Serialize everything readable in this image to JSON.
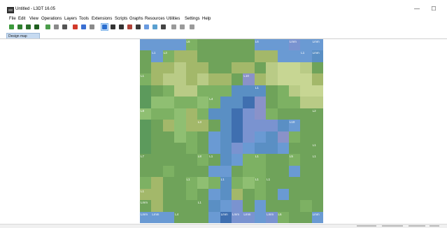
{
  "window": {
    "title": "Untitled - L3DT 16.05",
    "minimize_glyph": "—",
    "maximize_glyph": "☐"
  },
  "menu": {
    "items": [
      "File",
      "Edit",
      "View",
      "Operations",
      "Layers",
      "Tools",
      "Extensions",
      "Scripts",
      "Graphs",
      "Resources",
      "Utilities",
      "Settings",
      "Help"
    ]
  },
  "toolbar": {
    "buttons": [
      {
        "icon": "new-icon",
        "color": "#3c9a3c"
      },
      {
        "icon": "open-icon",
        "color": "#2f7f2f"
      },
      {
        "icon": "save-icon",
        "color": "#2a6f2a"
      },
      {
        "icon": "save-as-icon",
        "color": "#1f5f1f"
      },
      {
        "icon": "grid-icon",
        "color": "#4b9d4b"
      },
      {
        "icon": "arrows-icon",
        "color": "#8a8a8a"
      },
      {
        "icon": "stamp-icon",
        "color": "#555555"
      },
      {
        "icon": "pin-red-icon",
        "color": "#d23a2a"
      },
      {
        "icon": "pin-blue-icon",
        "color": "#3a6fd2"
      },
      {
        "icon": "filter-icon",
        "color": "#8a8a8a"
      },
      {
        "icon": "pointer-icon",
        "color": "#2b6fd0",
        "selected": true
      },
      {
        "icon": "pen-alt-icon",
        "color": "#333333"
      },
      {
        "icon": "pen-icon",
        "color": "#333333"
      },
      {
        "icon": "select-icon",
        "color": "#b0443a"
      },
      {
        "icon": "magnet-icon",
        "color": "#3a3a3a"
      },
      {
        "icon": "expand-icon",
        "color": "#6a9be0"
      },
      {
        "icon": "palette-icon",
        "color": "#5aa0d0"
      },
      {
        "icon": "flat-icon",
        "color": "#444444"
      },
      {
        "icon": "brush-icon",
        "color": "#9a9a9a"
      },
      {
        "icon": "terrain-icon",
        "color": "#9a9a9a"
      },
      {
        "icon": "number-icon",
        "color": "#9a9a9a"
      }
    ]
  },
  "tabs": [
    {
      "label": "Design map"
    }
  ],
  "colors": {
    "window_bg": "#ffffff",
    "tab_bg": "#c6daf1",
    "tab_border": "#9eb9d8",
    "map_label": "#ffffff",
    "terrain_legend": {
      "g1": "#6fa35a",
      "g2": "#7db163",
      "g3": "#8fbf72",
      "g4": "#5c9a5c",
      "y1": "#b9cb86",
      "y2": "#a3b86a",
      "y3": "#c7d693",
      "b1": "#5a8fc4",
      "b2": "#6a9ad3",
      "b3": "#7a93d0",
      "b4": "#3f6fb0",
      "b5": "#8a92c9"
    }
  },
  "map": {
    "grid_cols": 16,
    "grid_rows": 16,
    "terrain_rows": [
      [
        "b2",
        "b2",
        "b2",
        "b2",
        "g2",
        "g1",
        "g1",
        "g1",
        "g1",
        "g1",
        "b2",
        "b2",
        "b2",
        "b3",
        "b2",
        "b2"
      ],
      [
        "g1",
        "b2",
        "g2",
        "y2",
        "y2",
        "g1",
        "g1",
        "g1",
        "g1",
        "g1",
        "y2",
        "y2",
        "b2",
        "b2",
        "b2",
        "b1"
      ],
      [
        "g1",
        "y2",
        "y2",
        "y1",
        "y2",
        "y2",
        "g1",
        "g1",
        "y2",
        "y2",
        "g1",
        "y1",
        "y3",
        "y3",
        "y1",
        "g1"
      ],
      [
        "g2",
        "y2",
        "y1",
        "y1",
        "y2",
        "y1",
        "y2",
        "y2",
        "g1",
        "b5",
        "y2",
        "y1",
        "y3",
        "y3",
        "y3",
        "y2"
      ],
      [
        "g4",
        "g1",
        "g2",
        "y1",
        "y1",
        "g2",
        "g2",
        "g2",
        "b1",
        "b1",
        "b1",
        "g1",
        "g2",
        "y1",
        "y3",
        "y3"
      ],
      [
        "g4",
        "g3",
        "g3",
        "g2",
        "g2",
        "g3",
        "g2",
        "b1",
        "b1",
        "b4",
        "b5",
        "g1",
        "g2",
        "g2",
        "y1",
        "y1"
      ],
      [
        "g3",
        "g2",
        "g2",
        "g3",
        "y2",
        "g2",
        "b1",
        "b1",
        "b4",
        "b3",
        "b5",
        "g2",
        "g1",
        "g1",
        "g1",
        "g1"
      ],
      [
        "g4",
        "g1",
        "y2",
        "g3",
        "y2",
        "y2",
        "g1",
        "b1",
        "b4",
        "b3",
        "b3",
        "b3",
        "b1",
        "b2",
        "g1",
        "g1"
      ],
      [
        "g4",
        "g1",
        "g1",
        "g3",
        "g2",
        "g1",
        "b2",
        "b1",
        "b4",
        "b3",
        "b2",
        "b1",
        "b5",
        "g2",
        "g1",
        "g1"
      ],
      [
        "g4",
        "g1",
        "g1",
        "g1",
        "g2",
        "g1",
        "b2",
        "b1",
        "b3",
        "b2",
        "b1",
        "b1",
        "b2",
        "g1",
        "g1",
        "g1"
      ],
      [
        "g1",
        "g1",
        "g1",
        "g1",
        "g1",
        "g2",
        "g1",
        "b1",
        "b2",
        "g2",
        "g2",
        "g1",
        "g1",
        "g2",
        "g1",
        "g1"
      ],
      [
        "g1",
        "g1",
        "g2",
        "g1",
        "g1",
        "g1",
        "b2",
        "b2",
        "g1",
        "g2",
        "g2",
        "g1",
        "g1",
        "b2",
        "g1",
        "g1"
      ],
      [
        "g2",
        "y2",
        "g1",
        "g1",
        "g2",
        "g3",
        "g2",
        "b1",
        "g2",
        "g3",
        "g2",
        "g1",
        "g1",
        "g1",
        "g1",
        "g1"
      ],
      [
        "y2",
        "y2",
        "g1",
        "g1",
        "g2",
        "g1",
        "b2",
        "b1",
        "y2",
        "g1",
        "g2",
        "g1",
        "b2",
        "g1",
        "g1",
        "g1"
      ],
      [
        "g1",
        "y2",
        "g1",
        "g1",
        "g1",
        "g1",
        "b1",
        "b2",
        "b3",
        "g1",
        "b2",
        "g1",
        "g1",
        "g1",
        "g2",
        "g1"
      ],
      [
        "b2",
        "b2",
        "b2",
        "g1",
        "g1",
        "g1",
        "b2",
        "b4",
        "b3",
        "b3",
        "b2",
        "b3",
        "g2",
        "g1",
        "g1",
        "b2"
      ]
    ],
    "labels": [
      {
        "text": "L6",
        "col": 4,
        "row": 0
      },
      {
        "text": "L6",
        "col": 10,
        "row": 0
      },
      {
        "text": "Lmm",
        "col": 13,
        "row": 0
      },
      {
        "text": "Lmm",
        "col": 15,
        "row": 0
      },
      {
        "text": "L1",
        "col": 1,
        "row": 1
      },
      {
        "text": "L3",
        "col": 2,
        "row": 1
      },
      {
        "text": "L1",
        "col": 14,
        "row": 1
      },
      {
        "text": "Lmm",
        "col": 15,
        "row": 1
      },
      {
        "text": "L1",
        "col": 0,
        "row": 3
      },
      {
        "text": "L10",
        "col": 9,
        "row": 3
      },
      {
        "text": "L1",
        "col": 10,
        "row": 4
      },
      {
        "text": "L4",
        "col": 6,
        "row": 5
      },
      {
        "text": "L8",
        "col": 0,
        "row": 6
      },
      {
        "text": "L2",
        "col": 15,
        "row": 6
      },
      {
        "text": "L3",
        "col": 5,
        "row": 7
      },
      {
        "text": "L10",
        "col": 13,
        "row": 7
      },
      {
        "text": "L1",
        "col": 15,
        "row": 9
      },
      {
        "text": "L7",
        "col": 0,
        "row": 10
      },
      {
        "text": "L8",
        "col": 5,
        "row": 10
      },
      {
        "text": "L1",
        "col": 6,
        "row": 10
      },
      {
        "text": "L1",
        "col": 10,
        "row": 10
      },
      {
        "text": "L5",
        "col": 13,
        "row": 10
      },
      {
        "text": "L1",
        "col": 15,
        "row": 10
      },
      {
        "text": "L1",
        "col": 4,
        "row": 12
      },
      {
        "text": "L1",
        "col": 7,
        "row": 12
      },
      {
        "text": "L1",
        "col": 10,
        "row": 12
      },
      {
        "text": "L1",
        "col": 11,
        "row": 12
      },
      {
        "text": "L1",
        "col": 0,
        "row": 13
      },
      {
        "text": "Lmm",
        "col": 0,
        "row": 14
      },
      {
        "text": "L1",
        "col": 5,
        "row": 14
      },
      {
        "text": "Lmm",
        "col": 0,
        "row": 15
      },
      {
        "text": "Lmm",
        "col": 1,
        "row": 15
      },
      {
        "text": "L4",
        "col": 3,
        "row": 15
      },
      {
        "text": "Lmm",
        "col": 7,
        "row": 15
      },
      {
        "text": "Lmm",
        "col": 8,
        "row": 15
      },
      {
        "text": "Lmm",
        "col": 9,
        "row": 15
      },
      {
        "text": "Lmm",
        "col": 11,
        "row": 15
      },
      {
        "text": "L6",
        "col": 12,
        "row": 15
      },
      {
        "text": "Lmm",
        "col": 15,
        "row": 15
      }
    ]
  }
}
